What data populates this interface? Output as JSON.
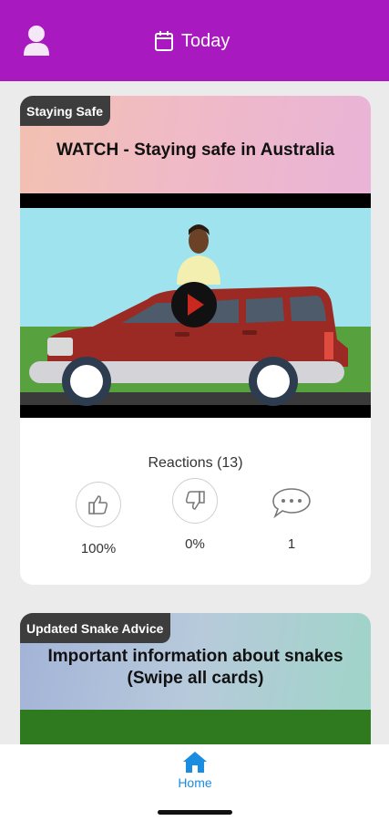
{
  "header": {
    "title": "Today",
    "profile_icon": "person-icon",
    "calendar_icon": "calendar-icon",
    "bg_color": "#a819bf"
  },
  "cards": [
    {
      "tag": "Staying Safe",
      "title": "WATCH - Staying safe in Australia",
      "media": "video",
      "reactions_label": "Reactions (13)",
      "like_percent": "100%",
      "dislike_percent": "0%",
      "comments": "1"
    },
    {
      "tag": "Updated Snake Advice",
      "title": "Important information about snakes (Swipe all cards)"
    }
  ],
  "bottom_nav": {
    "home_label": "Home",
    "accent": "#1a8de0"
  }
}
